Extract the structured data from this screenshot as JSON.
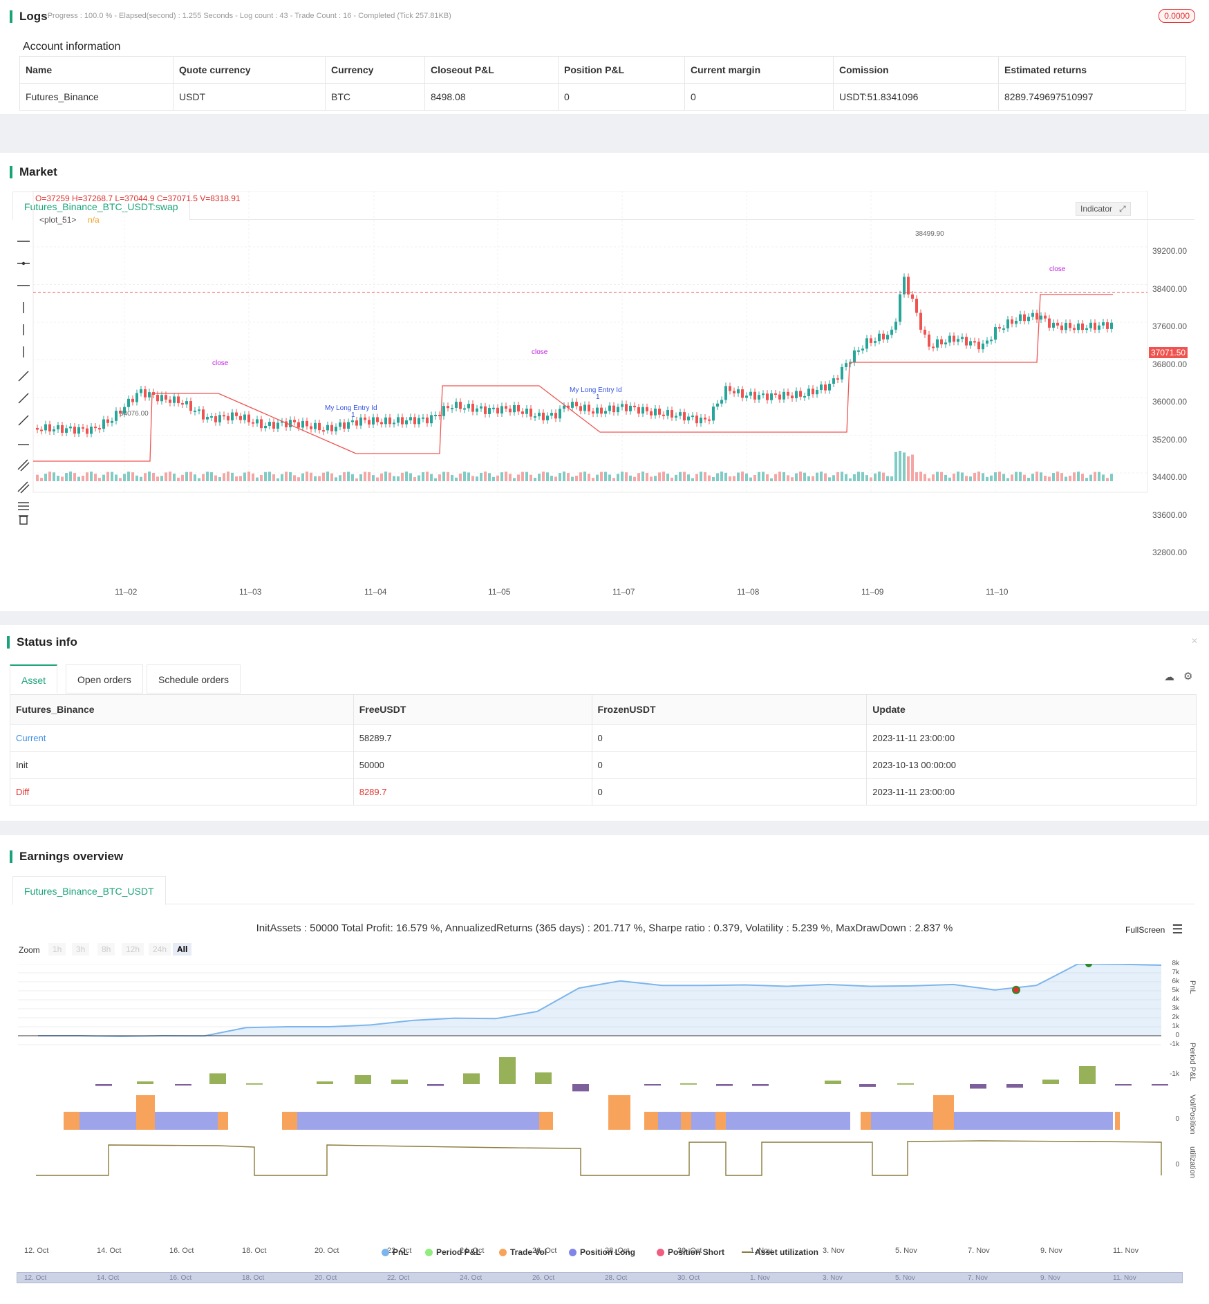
{
  "logs": {
    "title": "Logs",
    "summary": "- Progress : 100.0 % - Elapsed(second) : 1.255  Seconds - Log count : 43 - Trade Count : 16 - Completed (Tick 257.81KB)",
    "badge": "0.0000"
  },
  "account": {
    "title": "Account information",
    "headers": [
      "Name",
      "Quote currency",
      "Currency",
      "Closeout P&L",
      "Position P&L",
      "Current margin",
      "Comission",
      "Estimated returns"
    ],
    "row": [
      "Futures_Binance",
      "USDT",
      "BTC",
      "8498.08",
      "0",
      "0",
      "USDT:51.8341096",
      "8289.749697510997"
    ]
  },
  "market": {
    "title": "Market",
    "tab": "Futures_Binance_BTC_USDT:swap",
    "ohlc": "O=37259 H=37268.7 L=37044.9 C=37071.5 V=8318.91",
    "plot_label": "<plot_51>",
    "plot_value": "n/a",
    "indicator_btn": "Indicator",
    "last_price": "37071.50",
    "high_label": "38499.90",
    "low_label": "34076.00",
    "yticks": [
      "39200.00",
      "38400.00",
      "37600.00",
      "36800.00",
      "36000.00",
      "35200.00",
      "34400.00",
      "33600.00",
      "32800.00"
    ],
    "xticks": [
      "11–02",
      "11–03",
      "11–04",
      "11–05",
      "11–07",
      "11–08",
      "11–09",
      "11–10"
    ],
    "annotations": [
      "close",
      "close",
      "close",
      "My Long Entry Id",
      "My Long Entry Id",
      "1",
      "1"
    ]
  },
  "status": {
    "title": "Status info",
    "tabs": [
      "Asset",
      "Open orders",
      "Schedule orders"
    ],
    "headers": [
      "Futures_Binance",
      "FreeUSDT",
      "FrozenUSDT",
      "Update"
    ],
    "rows": [
      [
        "Current",
        "58289.7",
        "0",
        "2023-11-11 23:00:00"
      ],
      [
        "Init",
        "50000",
        "0",
        "2023-10-13 00:00:00"
      ],
      [
        "Diff",
        "8289.7",
        "0",
        "2023-11-11 23:00:00"
      ]
    ],
    "colors": {
      "current": "#3a8ee6",
      "diff": "#e0312f"
    }
  },
  "earnings": {
    "title": "Earnings overview",
    "tab": "Futures_Binance_BTC_USDT",
    "summary": "InitAssets : 50000 Total Profit: 16.579 %, AnnualizedReturns (365 days) : 201.717 %, Sharpe ratio : 0.379, Volatility : 5.239 %, MaxDrawDown : 2.837 %",
    "fullscreen": "FullScreen",
    "zoom_label": "Zoom",
    "zoom_options": [
      "1h",
      "3h",
      "8h",
      "12h",
      "24h",
      "All"
    ],
    "pnl_ticks": [
      "8k",
      "7k",
      "6k",
      "5k",
      "4k",
      "3k",
      "2k",
      "1k",
      "0",
      "-1k"
    ],
    "period_tick": "-1k",
    "vol_tick": "0",
    "util_tick": "0",
    "axis_titles": [
      "PnL",
      "Period P&L",
      "Vol/Position",
      "utilization"
    ],
    "xticks": [
      "12. Oct",
      "14. Oct",
      "16. Oct",
      "18. Oct",
      "20. Oct",
      "22. Oct",
      "24. Oct",
      "26. Oct",
      "28. Oct",
      "30. Oct",
      "1. Nov",
      "3. Nov",
      "5. Nov",
      "7. Nov",
      "9. Nov",
      "11. Nov"
    ],
    "legend": [
      {
        "name": "PnL",
        "color": "#7cb5ec"
      },
      {
        "name": "Period P&L",
        "color": "#90ed7d"
      },
      {
        "name": "Trade Vol",
        "color": "#f7a35c"
      },
      {
        "name": "Position Long",
        "color": "#8085e9"
      },
      {
        "name": "Position Short",
        "color": "#f15c80"
      },
      {
        "name": "Asset utilization",
        "color": "#8a7a3a"
      }
    ]
  },
  "chart_data": {
    "type": "line",
    "title": "",
    "series": [
      {
        "name": "PnL",
        "values": [
          0,
          0,
          -80,
          0,
          -20,
          900,
          1000,
          1000,
          1200,
          1700,
          1950,
          1900,
          2700,
          5300,
          6100,
          5600,
          5600,
          5650,
          5500,
          5700,
          5500,
          5550,
          5700,
          5100,
          5600,
          8000,
          7950,
          7850
        ]
      }
    ],
    "ylim": [
      -1000,
      8500
    ]
  }
}
